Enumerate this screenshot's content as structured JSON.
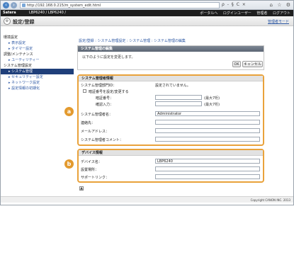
{
  "browser": {
    "url": "http://192.168.0.215/m_system_edit.html",
    "addr_actions": "ρ - § C ×",
    "tabs_icons": "⌂ ☆ ⚙"
  },
  "device": {
    "brand": "Satera",
    "name": "LBP6240 / LBP6240 /",
    "links": [
      "ポータルへ",
      "ログインユーザー",
      "管理者",
      "ログアウト"
    ]
  },
  "title": {
    "icon": "⚙",
    "text": "設定/登録",
    "link": "管理者モード"
  },
  "sidebar": {
    "groups": [
      {
        "label": "環境設定",
        "items": [
          "表示設定",
          "タイマー設定"
        ]
      },
      {
        "label": "調整/メンテナンス",
        "items": [
          "ユーティリティー"
        ]
      },
      {
        "label": "システム管理設定",
        "items": [
          "システム管理",
          "セキュリティー設定",
          "ネットワーク設定",
          "設定情報の初期化"
        ]
      }
    ]
  },
  "main": {
    "breadcrumb": "設定/登録 : システム管理設定 : システム管理 : システム管理の編集",
    "confirm_heading": "システム管理の編集",
    "confirm_message": "以下のように設定を変更します。",
    "ok_label": "OK",
    "cancel_label": "キャンセル"
  },
  "admin_section": {
    "heading": "システム管理者情報",
    "id_label": "システム管理部門ID：",
    "id_status": "設定されていません。",
    "change_pin_label": "暗証番号を設定/変更する",
    "pin_label": "暗証番号：",
    "pin_confirm_label": "確認入力：",
    "pin_hint": "(最大7桁)",
    "name_label": "システム管理者名：",
    "name_value": "Administrator",
    "contact_label": "連絡先：",
    "email_label": "メールアドレス：",
    "comment_label": "システム管理者コメント：",
    "badge": "a"
  },
  "device_section": {
    "heading": "デバイス情報",
    "name_label": "デバイス名：",
    "name_value": "LBP6240",
    "location_label": "設置場所：",
    "support_label": "サポートリンク：",
    "badge": "b"
  },
  "footer": {
    "top_arrow": "▲",
    "copyright": "Copyright CANON INC. 2013"
  }
}
